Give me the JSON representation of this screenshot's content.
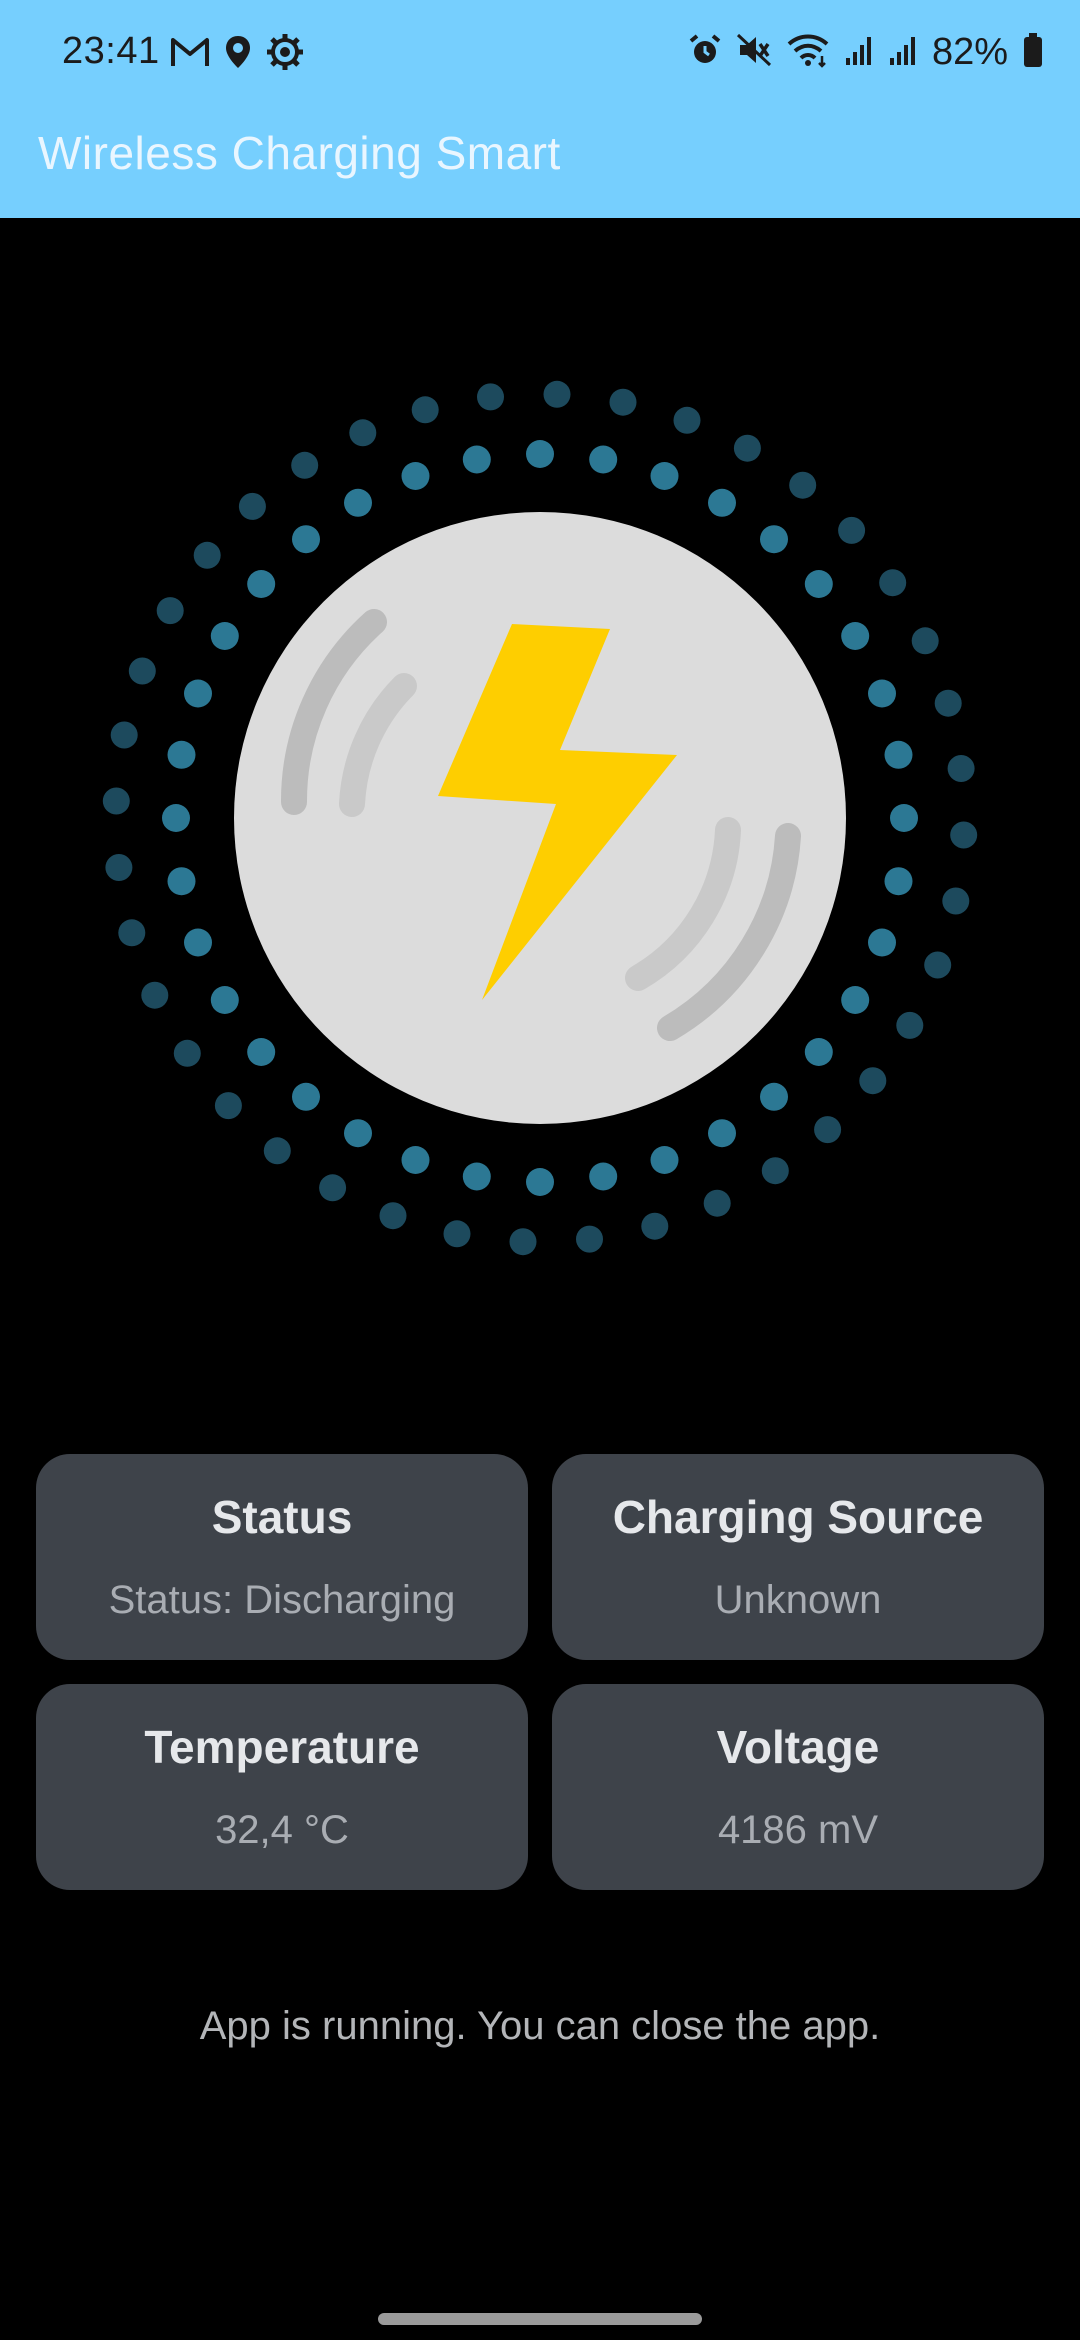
{
  "status_bar": {
    "time": "23:41",
    "left_icons": [
      "gmail-icon",
      "location-icon",
      "settings-icon"
    ],
    "right_icons": [
      "alarm-icon",
      "mute-icon",
      "wifi-icon",
      "signal-icon",
      "signal-icon",
      "battery-icon"
    ],
    "battery": "82%"
  },
  "app_bar": {
    "title": "Wireless Charging Smart",
    "color": "#76CFFE"
  },
  "hero": {
    "icon": "wireless-charging-icon",
    "colors": {
      "disc": "#DCDCDC",
      "bolt": "#FECE00",
      "dots_inner": "#2C7894",
      "dots_outer": "#1D4A5D"
    }
  },
  "cards": [
    {
      "title": "Status",
      "value": "Status: Discharging"
    },
    {
      "title": "Charging Source",
      "value": "Unknown"
    },
    {
      "title": "Temperature",
      "value": "32,4 °C"
    },
    {
      "title": "Voltage",
      "value": "4186 mV"
    }
  ],
  "footer": {
    "message": "App is running. You can close the app."
  }
}
